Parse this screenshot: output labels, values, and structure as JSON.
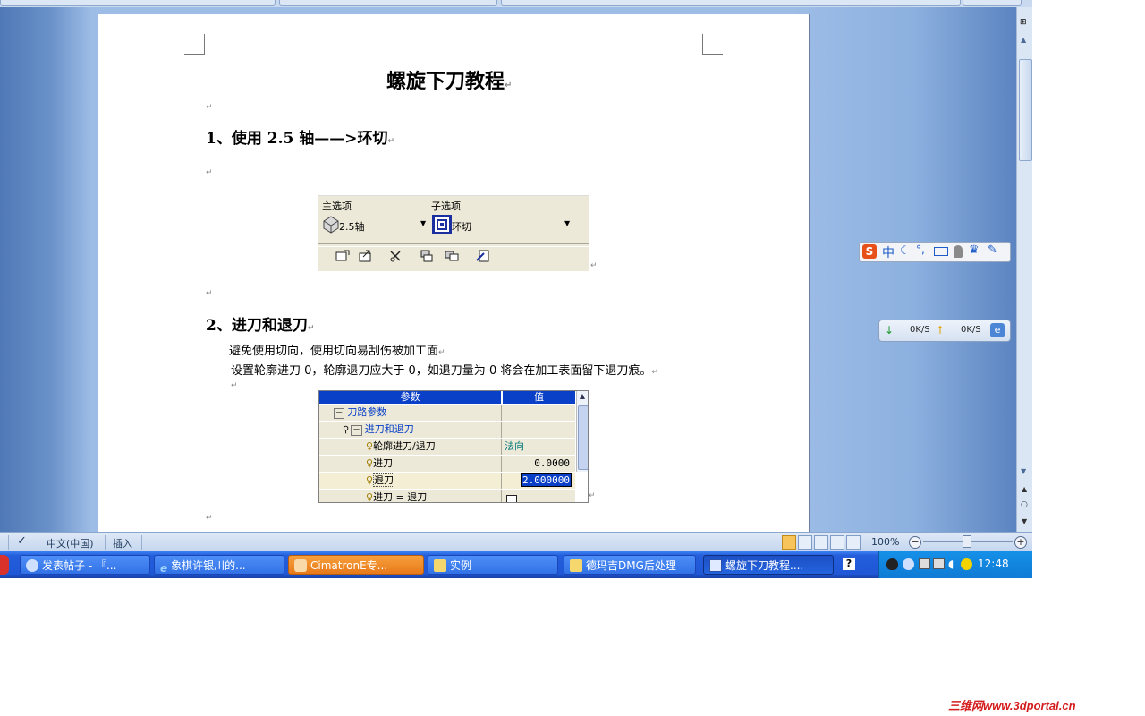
{
  "document": {
    "title": "螺旋下刀教程",
    "section1": "1、使用 2.5 轴——>环切",
    "section2": "2、进刀和退刀",
    "para1": "避免使用切向，使用切向易刮伤被加工面",
    "para2": "设置轮廓进刀 0，轮廓退刀应大于 0，如退刀量为 0 将会在加工表面留下退刀痕。"
  },
  "options_panel": {
    "main_label": "主选项",
    "sub_label": "子选项",
    "main_value": "2.5轴",
    "sub_value": "环切"
  },
  "param_table": {
    "col_param": "参数",
    "col_value": "值",
    "rows": [
      {
        "name": "刀路参数",
        "value": ""
      },
      {
        "name": "进刀和退刀",
        "value": ""
      },
      {
        "name": "轮廓进刀/退刀",
        "value": "法向"
      },
      {
        "name": "进刀",
        "value": "0.0000"
      },
      {
        "name": "退刀",
        "value": "2.000000"
      },
      {
        "name": "进刀 = 退刀",
        "value": ""
      }
    ]
  },
  "statusbar": {
    "language": "中文(中国)",
    "mode": "插入",
    "zoom": "100%"
  },
  "taskbar": {
    "items": [
      {
        "label": "发表帖子 - 『..."
      },
      {
        "label": "象棋许银川的..."
      },
      {
        "label": "CimatronE专..."
      },
      {
        "label": "实例"
      },
      {
        "label": "德玛吉DMG后处理"
      },
      {
        "label": "螺旋下刀教程...."
      },
      {
        "label": "?"
      }
    ],
    "clock": "12:48"
  },
  "ime_bar": {
    "symbol": "S",
    "mode": "中"
  },
  "net_monitor": {
    "down": "0K/S",
    "up": "0K/S"
  },
  "watermark": "三维网www.3dportal.cn",
  "colors": {
    "accent": "#0a40c8",
    "taskbar": "#245edb",
    "watermark": "#d41e1e"
  }
}
